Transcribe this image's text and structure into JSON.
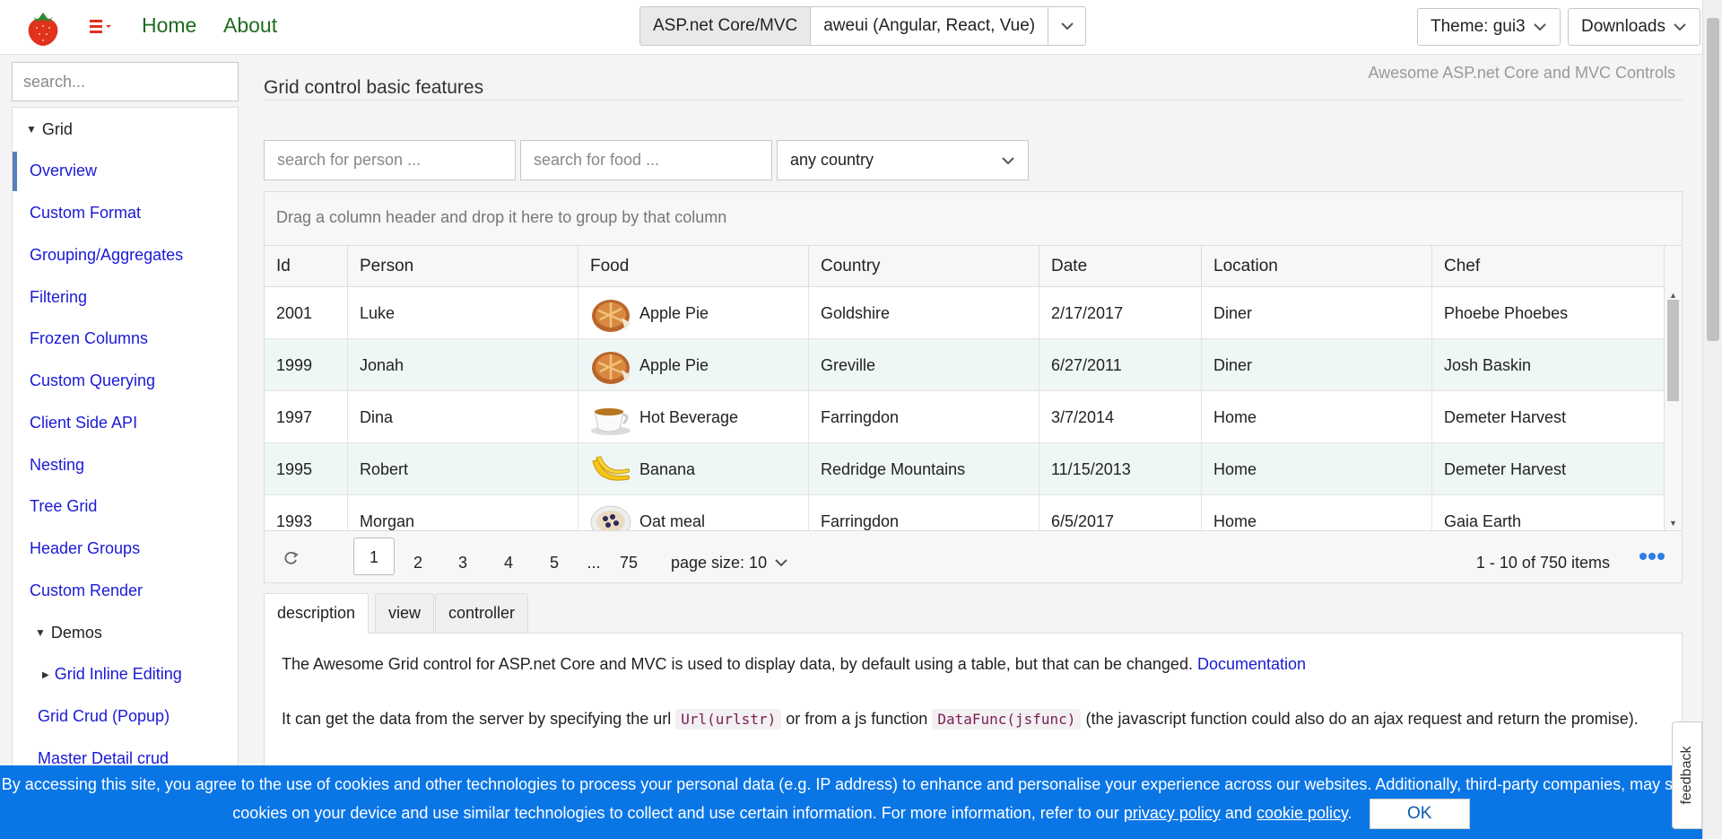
{
  "nav": {
    "links": [
      "Home",
      "About"
    ],
    "framework_tabs": [
      "ASP.net Core/MVC",
      "aweui (Angular, React, Vue)"
    ],
    "theme_label": "Theme: gui3",
    "downloads_label": "Downloads"
  },
  "sidebar": {
    "search_placeholder": "search...",
    "items": [
      {
        "label": "Grid"
      },
      {
        "label": "Overview"
      },
      {
        "label": "Custom Format"
      },
      {
        "label": "Grouping/Aggregates"
      },
      {
        "label": "Filtering"
      },
      {
        "label": "Frozen Columns"
      },
      {
        "label": "Custom Querying"
      },
      {
        "label": "Client Side API"
      },
      {
        "label": "Nesting"
      },
      {
        "label": "Tree Grid"
      },
      {
        "label": "Header Groups"
      },
      {
        "label": "Custom Render"
      },
      {
        "label": "Demos"
      },
      {
        "label": "Grid Inline Editing"
      },
      {
        "label": "Grid Crud (Popup)"
      },
      {
        "label": "Master Detail crud"
      }
    ]
  },
  "main": {
    "title": "Grid control basic features",
    "brand_subtitle": "Awesome ASP.net Core and MVC Controls",
    "filters": {
      "person_placeholder": "search for person ...",
      "food_placeholder": "search for food ...",
      "country_value": "any country"
    }
  },
  "grid": {
    "group_hint": "Drag a column header and drop it here to group by that column",
    "columns": [
      "Id",
      "Person",
      "Food",
      "Country",
      "Date",
      "Location",
      "Chef"
    ],
    "rows": [
      {
        "id": "2001",
        "person": "Luke",
        "food": "Apple Pie",
        "food_icon": "apple-pie-icon",
        "country": "Goldshire",
        "date": "2/17/2017",
        "location": "Diner",
        "chef": "Phoebe Phoebes"
      },
      {
        "id": "1999",
        "person": "Jonah",
        "food": "Apple Pie",
        "food_icon": "apple-pie-icon",
        "country": "Greville",
        "date": "6/27/2011",
        "location": "Diner",
        "chef": "Josh Baskin"
      },
      {
        "id": "1997",
        "person": "Dina",
        "food": "Hot Beverage",
        "food_icon": "tea-cup-icon",
        "country": "Farringdon",
        "date": "3/7/2014",
        "location": "Home",
        "chef": "Demeter Harvest"
      },
      {
        "id": "1995",
        "person": "Robert",
        "food": "Banana",
        "food_icon": "banana-icon",
        "country": "Redridge Mountains",
        "date": "11/15/2013",
        "location": "Home",
        "chef": "Demeter Harvest"
      },
      {
        "id": "1993",
        "person": "Morgan",
        "food": "Oat meal",
        "food_icon": "oat-meal-icon",
        "country": "Farringdon",
        "date": "6/5/2017",
        "location": "Home",
        "chef": "Gaia Earth"
      }
    ],
    "pager": {
      "pages": [
        "1",
        "2",
        "3",
        "4",
        "5",
        "...",
        "75"
      ],
      "current_page": "1",
      "page_size_label": "page size: 10",
      "items_info": "1 - 10 of 750 items"
    }
  },
  "tabs": [
    "description",
    "view",
    "controller"
  ],
  "description": {
    "p1_text": "The Awesome Grid control for ASP.net Core and MVC is used to display data, by default using a table, but that can be changed.",
    "p1_link": "Documentation",
    "p2_a": "It can get the data from the server by specifying the url",
    "p2_code1": "Url(urlstr)",
    "p2_b": "or from a js function",
    "p2_code2": "DataFunc(jsfunc)",
    "p2_c": "(the javascript function could also do an ajax request and return the promise)."
  },
  "cookie": {
    "text_1": "By accessing this site, you agree to the use of cookies and other technologies to process your personal data (e.g. IP address) to enhance and personalise your experience across our websites. Additionally, third-party companies, may store cookies on your device and use similar technologies to collect and use certain information. For more information, refer to our",
    "privacy_link": "privacy policy",
    "and_text": "and",
    "cookie_link": "cookie policy",
    "ok_label": "OK"
  },
  "feedback_label": "feedback",
  "colors": {
    "accent_link": "#1a1ad6",
    "nav_green": "#1f6b1f",
    "cookie_banner": "#0a76e6",
    "alt_row": "#eef6f6"
  }
}
